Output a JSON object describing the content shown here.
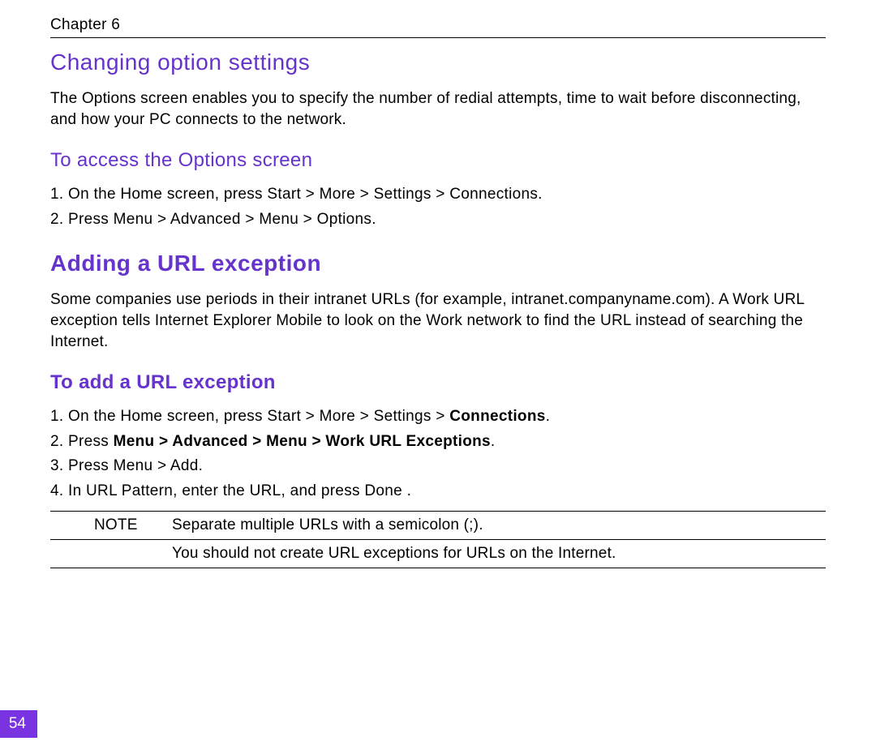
{
  "header": {
    "chapter_label": "Chapter 6"
  },
  "section1": {
    "title": "Changing option settings",
    "intro": "The Options screen enables you to specify the number of redial attempts, time to wait before disconnecting, and how your PC connects to the network.",
    "subheading": "To access the Options screen",
    "step1_num": "1.",
    "step1_text": "On the Home screen, press Start > More > Settings > Connections.",
    "step2_num": "2.",
    "step2_text": "Press Menu  > Advanced > Menu  > Options."
  },
  "section2": {
    "title": "Adding a URL exception",
    "intro": "Some companies use periods in their intranet URLs (for example, intranet.companyname.com). A Work URL exception tells Internet Explorer Mobile to look on the Work network to find the URL instead of searching the Internet.",
    "subheading": "To add a URL exception",
    "step1_num": "1.",
    "step1_pre": "On the Home screen, press Start > More > Settings > ",
    "step1_bold": "Connections",
    "step1_post": ".",
    "step2_num": "2.",
    "step2_pre": "Press ",
    "step2_bold": "Menu > Advanced > Menu > Work URL Exceptions",
    "step2_post": ".",
    "step3_num": "3.",
    "step3_text": "Press Menu > Add.",
    "step4_num": "4.",
    "step4_text": "In URL Pattern, enter the URL, and press Done .",
    "note_label": "NOTE",
    "note_line1": "Separate multiple URLs with a semicolon (;).",
    "note_line2": "You should not create URL exceptions for URLs on the Internet."
  },
  "footer": {
    "page_number": "54"
  }
}
